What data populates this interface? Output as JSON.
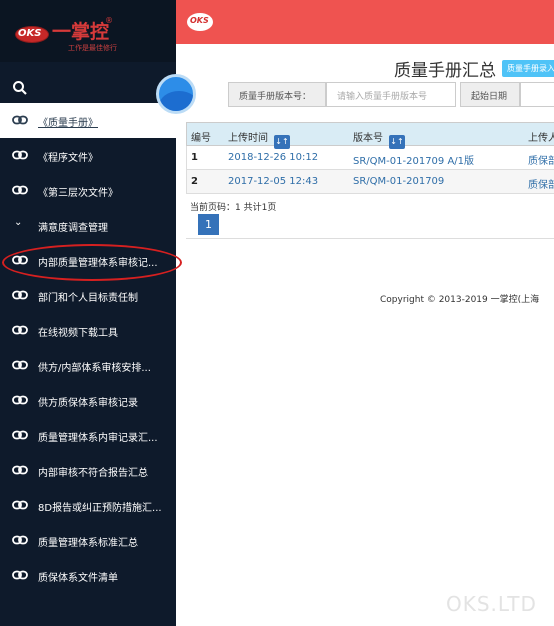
{
  "brand": {
    "logo_text": "OKS",
    "name": "一掌控",
    "reg": "®",
    "subtitle": "工作是最佳修行"
  },
  "topbar": {
    "logo_text": "OKS"
  },
  "sidebar": {
    "items": [
      {
        "label": "《质量手册》",
        "active": true
      },
      {
        "label": "《程序文件》"
      },
      {
        "label": "《第三层次文件》"
      },
      {
        "label": "满意度调查管理",
        "group": true
      },
      {
        "label": "内部质量管理体系审核记..."
      },
      {
        "label": "部门和个人目标责任制"
      },
      {
        "label": "在线视频下载工具"
      },
      {
        "label": "供方/内部体系审核安排..."
      },
      {
        "label": "供方质保体系审核记录"
      },
      {
        "label": "质量管理体系内审记录汇..."
      },
      {
        "label": "内部审核不符合报告汇总"
      },
      {
        "label": "8D报告或纠正预防措施汇..."
      },
      {
        "label": "质量管理体系标准汇总"
      },
      {
        "label": "质保体系文件清单"
      }
    ]
  },
  "main": {
    "title": "质量手册汇总",
    "badge": "质量手册录入",
    "filters": {
      "version_label": "质量手册版本号：",
      "version_placeholder": "请输入质量手册版本号",
      "start_date_label": "起始日期"
    },
    "table": {
      "headers": [
        "编号",
        "上传时间",
        "版本号",
        "上传人"
      ],
      "sort_glyph": "↓↑",
      "rows": [
        {
          "no": "1",
          "time": "2018-12-26 10:12",
          "version": "SR/QM-01-201709 A/1版",
          "uploader": "质保部"
        },
        {
          "no": "2",
          "time": "2017-12-05 12:43",
          "version": "SR/QM-01-201709",
          "uploader": "质保部"
        }
      ]
    },
    "pager_info": "当前页码：1 共计1页",
    "current_page": "1",
    "copyright": "Copyright © 2013-2019 一掌控(上海"
  },
  "watermark": "OKS.LTD",
  "colors": {
    "sidebar_bg": "#0e1a2b",
    "topbar_bg": "#ef5350",
    "accent": "#3572b9",
    "highlight": "#d62020"
  }
}
